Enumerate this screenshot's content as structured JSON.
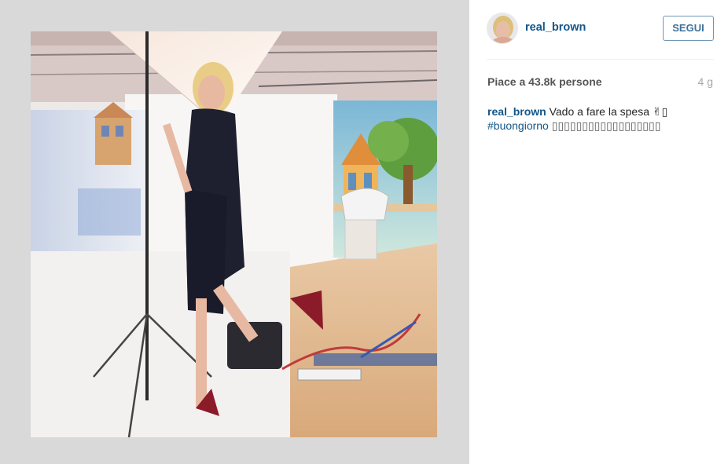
{
  "post": {
    "username": "real_brown",
    "follow_label": "SEGUI",
    "likes_text": "Piace a 43.8k persone",
    "time_ago": "4 g",
    "caption": {
      "username": "real_brown",
      "text": "Vado a fare la spesa ✌▯",
      "hashtag": "#buongiorno",
      "trailing": "▯▯▯▯▯▯▯▯▯▯▯▯▯▯▯▯▯▯"
    }
  },
  "icons": {
    "avatar": "profile-avatar",
    "photo": "post-photo"
  },
  "colors": {
    "username_blue": "#125688",
    "button_blue": "#3f729b",
    "panel_gray": "#d9d9d9"
  }
}
